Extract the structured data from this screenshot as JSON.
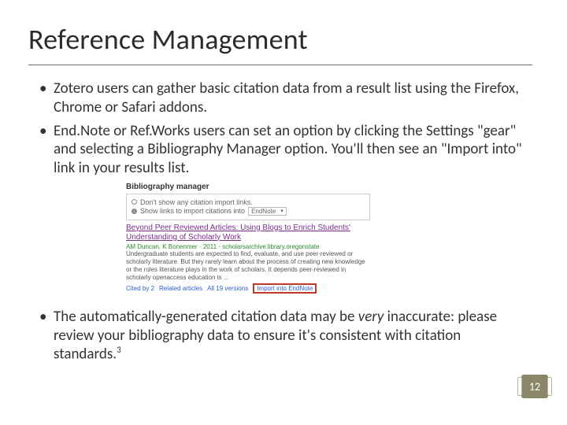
{
  "title": "Reference Management",
  "bullets": {
    "b1": "Zotero users can gather basic citation data from a result list using the Firefox, Chrome or Safari addons.",
    "b2": "End.Note or Ref.Works users can set an option by clicking the Settings \"gear\" and selecting a Bibliography Manager option. You'll then see an \"Import into\" link in your results list.",
    "b3_pre": "The automatically-generated citation data may be ",
    "b3_em": "very",
    "b3_post": " inaccurate: please review your bibliography data to ensure it's consistent with citation standards.",
    "b3_sup": "3"
  },
  "figure": {
    "header": "Bibliography manager",
    "opt1": "Don't show any citation import links.",
    "opt2_prefix": "Show links to import citations into",
    "opt2_dropdown": "EndNote",
    "result_title": "Beyond Peer Reviewed Articles: Using Blogs to Enrich Students' Understanding of Scholarly Work",
    "result_meta": "AM Duncan, K Bonenmer · 2011 · scholarsarchive.library.oregonstate",
    "result_snip": "Undergraduate students are expected to find, evaluate, and use peer-reviewed or scholarly literature. But they rarely learn about the process of creating new knowledge or the roles literature plays in the work of scholars. It depends peer-reviewed in scholarly openaccess education is ...",
    "link_citedby": "Cited by 2",
    "link_related": "Related articles",
    "link_versions": "All 19 versions",
    "link_import": "Import into EndNote"
  },
  "page_number": "12"
}
